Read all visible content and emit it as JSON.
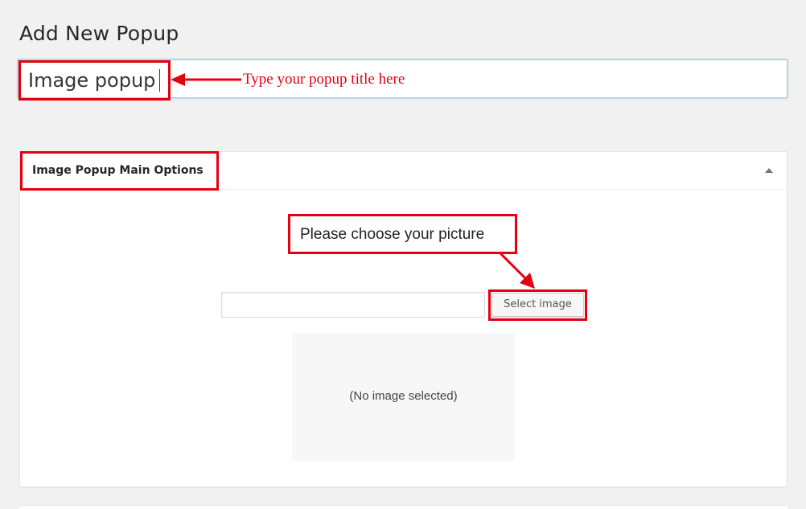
{
  "page": {
    "title": "Add New Popup"
  },
  "title_field": {
    "value": "Image popup",
    "annotation": "Type your popup title here"
  },
  "metabox": {
    "title": "Image Popup Main Options",
    "toggle_icon": "triangle-up-icon",
    "choose_label": "Please choose your picture",
    "image_url_value": "",
    "select_button_label": "Select image",
    "preview_text": "(No image selected)"
  },
  "colors": {
    "annotation_red": "#e4000f",
    "background": "#f1f1f1",
    "panel": "#ffffff"
  }
}
